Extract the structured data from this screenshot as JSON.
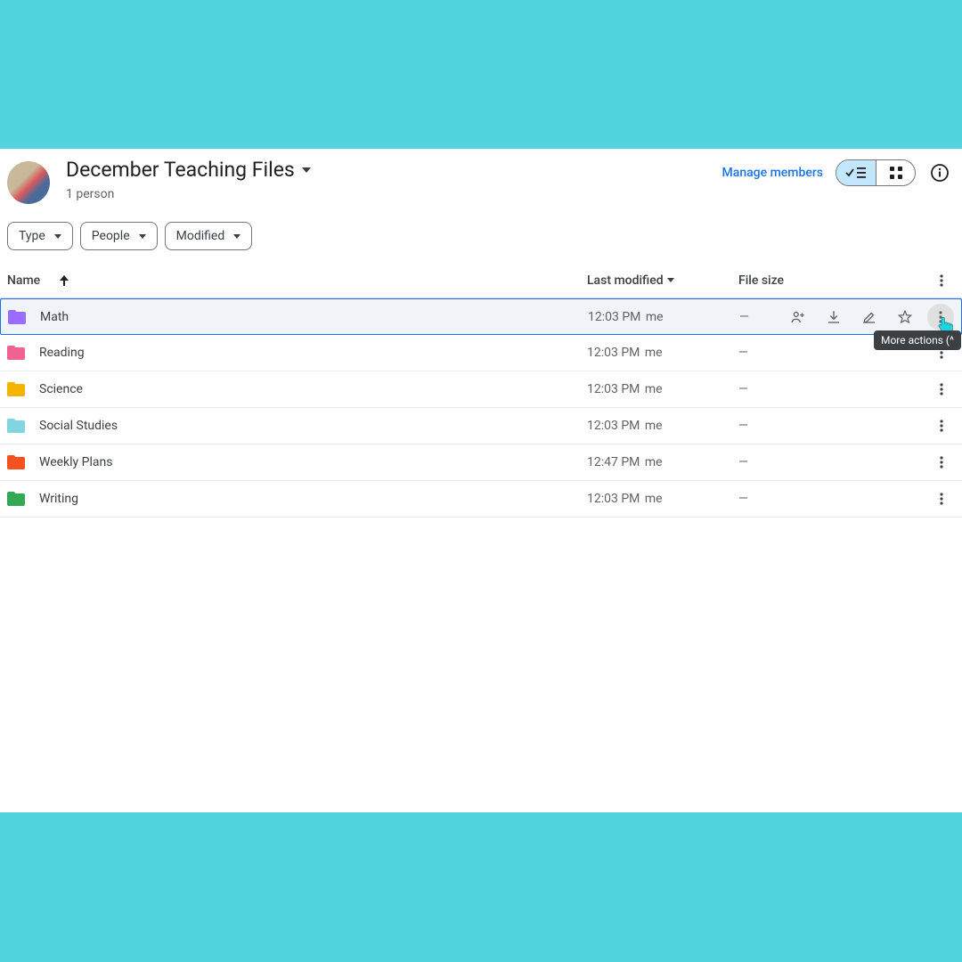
{
  "header": {
    "title": "December Teaching Files",
    "subtitle": "1 person",
    "manage": "Manage members"
  },
  "filters": {
    "type": "Type",
    "people": "People",
    "modified": "Modified"
  },
  "columns": {
    "name": "Name",
    "modified": "Last modified",
    "size": "File size"
  },
  "rows": [
    {
      "name": "Math",
      "color": "#9b6dff",
      "time": "12:03 PM",
      "by": "me",
      "size": "—",
      "selected": true
    },
    {
      "name": "Reading",
      "color": "#f06292",
      "time": "12:03 PM",
      "by": "me",
      "size": "—"
    },
    {
      "name": "Science",
      "color": "#f5b400",
      "time": "12:03 PM",
      "by": "me",
      "size": "—"
    },
    {
      "name": "Social Studies",
      "color": "#81d4e0",
      "time": "12:03 PM",
      "by": "me",
      "size": "—"
    },
    {
      "name": "Weekly Plans",
      "color": "#f4511e",
      "time": "12:47 PM",
      "by": "me",
      "size": "—"
    },
    {
      "name": "Writing",
      "color": "#34a853",
      "time": "12:03 PM",
      "by": "me",
      "size": "—"
    }
  ],
  "tooltip": "More actions (^"
}
